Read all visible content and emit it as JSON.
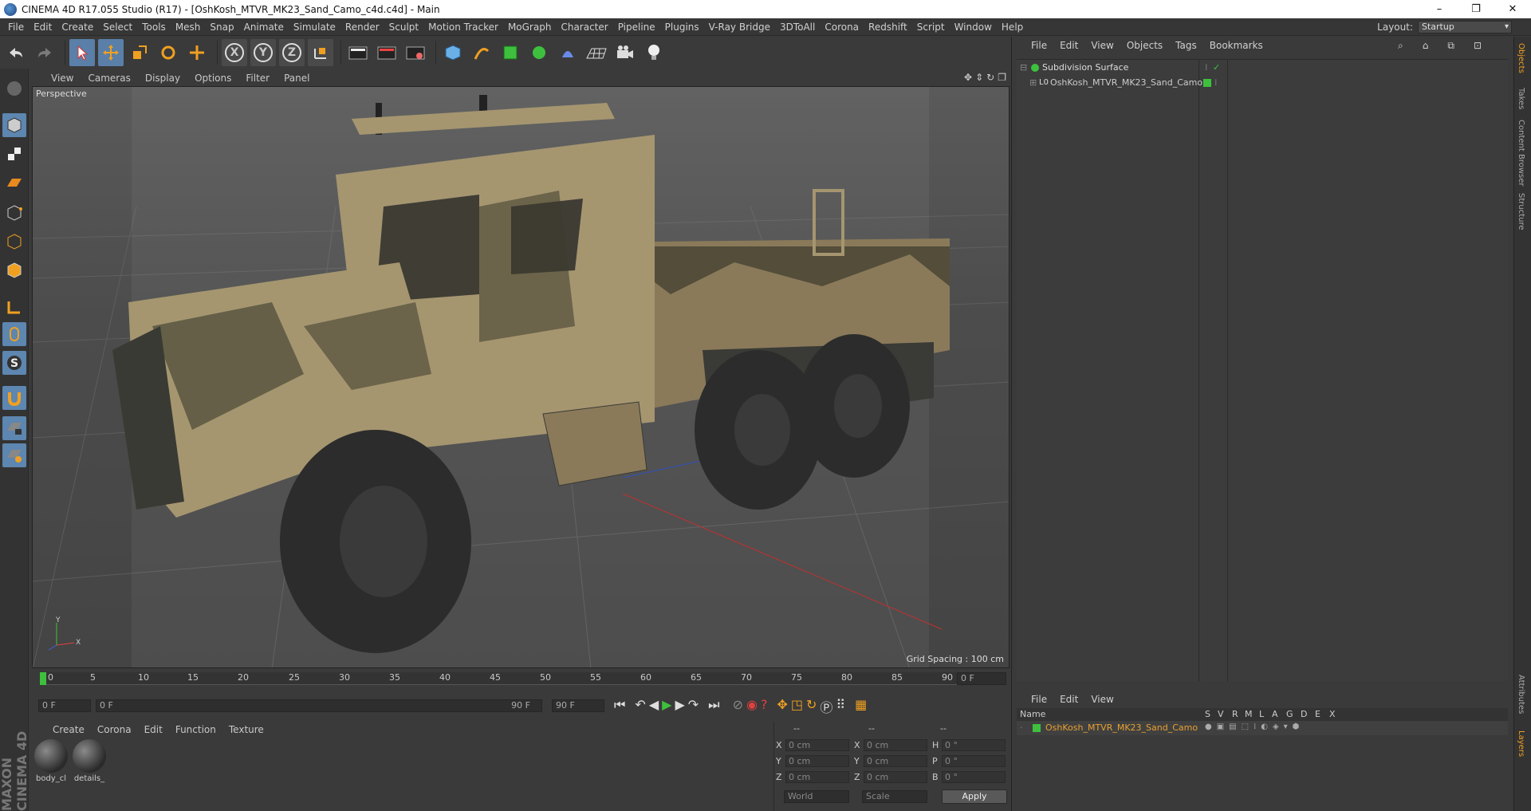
{
  "window": {
    "title": "CINEMA 4D R17.055 Studio (R17) - [OshKosh_MTVR_MK23_Sand_Camo_c4d.c4d] - Main",
    "minimize": "–",
    "restore": "❐",
    "close": "✕"
  },
  "menu": [
    "File",
    "Edit",
    "Create",
    "Select",
    "Tools",
    "Mesh",
    "Snap",
    "Animate",
    "Simulate",
    "Render",
    "Sculpt",
    "Motion Tracker",
    "MoGraph",
    "Character",
    "Pipeline",
    "Plugins",
    "V-Ray Bridge",
    "3DToAll",
    "Corona",
    "Redshift",
    "Script",
    "Window",
    "Help"
  ],
  "layout": {
    "label": "Layout:",
    "value": "Startup"
  },
  "toolbar": {
    "x": "X",
    "y": "Y",
    "z": "Z"
  },
  "viewport": {
    "menu": [
      "View",
      "Cameras",
      "Display",
      "Options",
      "Filter",
      "Panel"
    ],
    "label": "Perspective",
    "grid_spacing": "Grid Spacing : 100 cm",
    "axis_y": "Y",
    "axis_x": "X"
  },
  "timeline": {
    "ticks": [
      "0",
      "5",
      "10",
      "15",
      "20",
      "25",
      "30",
      "35",
      "40",
      "45",
      "50",
      "55",
      "60",
      "65",
      "70",
      "75",
      "80",
      "85",
      "90"
    ],
    "frame_end_field": "0 F"
  },
  "anim": {
    "current": "0 F",
    "range_start": "0 F",
    "range_end": "90 F",
    "max": "90 F"
  },
  "materials": {
    "menu": [
      "Create",
      "Corona",
      "Edit",
      "Function",
      "Texture"
    ],
    "items": [
      {
        "name": "body_cl"
      },
      {
        "name": "details_"
      }
    ]
  },
  "coords": {
    "header": [
      "--",
      "--",
      "--"
    ],
    "rows": [
      {
        "a": "X",
        "av": "0 cm",
        "b": "X",
        "bv": "0 cm",
        "c": "H",
        "cv": "0 °"
      },
      {
        "a": "Y",
        "av": "0 cm",
        "b": "Y",
        "bv": "0 cm",
        "c": "P",
        "cv": "0 °"
      },
      {
        "a": "Z",
        "av": "0 cm",
        "b": "Z",
        "bv": "0 cm",
        "c": "B",
        "cv": "0 °"
      }
    ],
    "mode1": "World",
    "mode2": "Scale",
    "apply": "Apply"
  },
  "objects": {
    "menu": [
      "File",
      "Edit",
      "View",
      "Objects",
      "Tags",
      "Bookmarks"
    ],
    "items": [
      {
        "name": "Subdivision Surface"
      },
      {
        "name": "OshKosh_MTVR_MK23_Sand_Camo"
      }
    ]
  },
  "layers": {
    "menu": [
      "File",
      "Edit",
      "View"
    ],
    "header_name": "Name",
    "cols": [
      "S",
      "V",
      "R",
      "M",
      "L",
      "A",
      "G",
      "D",
      "E",
      "X"
    ],
    "row": "OshKosh_MTVR_MK23_Sand_Camo"
  },
  "right_tabs": [
    "Objects",
    "Takes",
    "Content Browser",
    "Structure",
    "Attributes",
    "Layers"
  ],
  "brand": "MAXON CINEMA 4D",
  "colors": {
    "accent_blue": "#5a7fa8",
    "green_tag": "#3ec03e",
    "selected_layer_text": "#e8a030"
  }
}
